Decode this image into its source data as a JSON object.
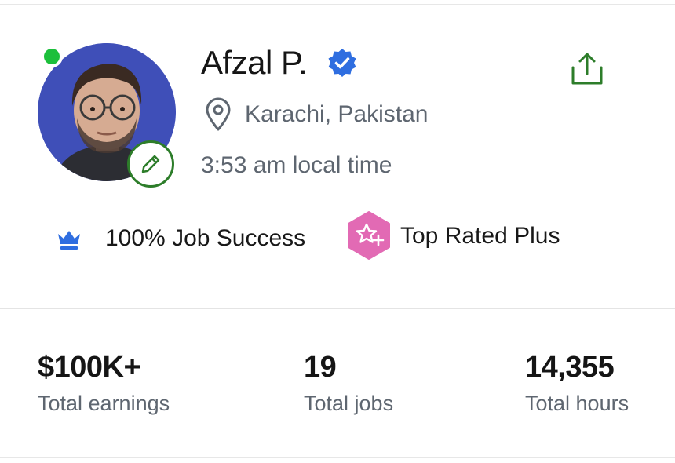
{
  "profile": {
    "name": "Afzal P.",
    "location": "Karachi, Pakistan",
    "local_time": "3:53 am local time",
    "online": true,
    "verified": true
  },
  "badges": {
    "job_success": "100% Job Success",
    "top_rated": "Top Rated Plus"
  },
  "stats": {
    "earnings_value": "$100K+",
    "earnings_label": "Total earnings",
    "jobs_value": "19",
    "jobs_label": "Total jobs",
    "hours_value": "14,355",
    "hours_label": "Total hours"
  },
  "icons": {
    "share": "share-icon",
    "edit": "pencil-icon",
    "location": "location-pin-icon",
    "verified": "verified-badge-icon",
    "job_success": "crown-icon",
    "top_rated": "top-rated-plus-icon"
  },
  "colors": {
    "green": "#2d7d2a",
    "online": "#1cbf3b",
    "verified_blue": "#2f6ee0",
    "crown_blue": "#2f6ee0",
    "top_rated_pink": "#e26ab4",
    "muted_text": "#5e6670",
    "avatar_bg": "#3f4fb8"
  }
}
